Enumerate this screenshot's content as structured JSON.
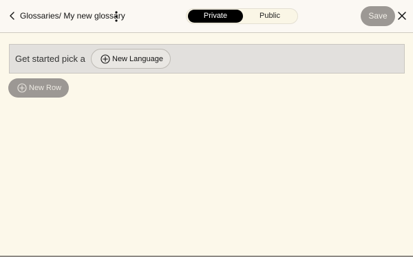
{
  "header": {
    "breadcrumb": "Glossaries/ My new glossary",
    "visibility": {
      "options": [
        "Private",
        "Public"
      ],
      "selected": "Private"
    },
    "save_label": "Save"
  },
  "editor": {
    "prompt_text": "Get started pick a",
    "new_language_label": "New Language",
    "new_row_label": "New Row"
  },
  "icons": {
    "back": "chevron-left-icon",
    "more": "vertical-dots-icon",
    "close": "close-icon",
    "add": "plus-circle-icon"
  },
  "colors": {
    "background": "#fcf8ea",
    "toggle_active": "#000000",
    "disabled_button": "#9c9894"
  }
}
